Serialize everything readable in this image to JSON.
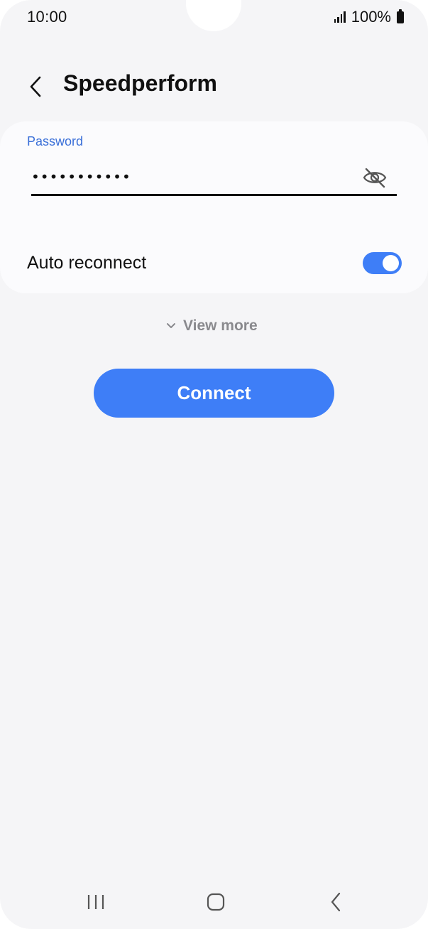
{
  "status_bar": {
    "time": "10:00",
    "battery_text": "100%"
  },
  "header": {
    "title": "Speedperform"
  },
  "password_field": {
    "label": "Password",
    "value": "•••••••••••"
  },
  "auto_reconnect": {
    "label": "Auto reconnect",
    "enabled": true
  },
  "view_more": {
    "label": "View more"
  },
  "connect": {
    "label": "Connect"
  },
  "colors": {
    "accent": "#3e7ef7",
    "label_blue": "#3a6fd8",
    "background": "#f5f5f7",
    "card": "#fbfbfd"
  },
  "icons": {
    "back": "chevron-left-icon",
    "password_visibility": "eye-off-icon",
    "view_more": "chevron-down-icon",
    "nav_recents": "recents-icon",
    "nav_home": "home-icon",
    "nav_back": "nav-back-icon"
  }
}
